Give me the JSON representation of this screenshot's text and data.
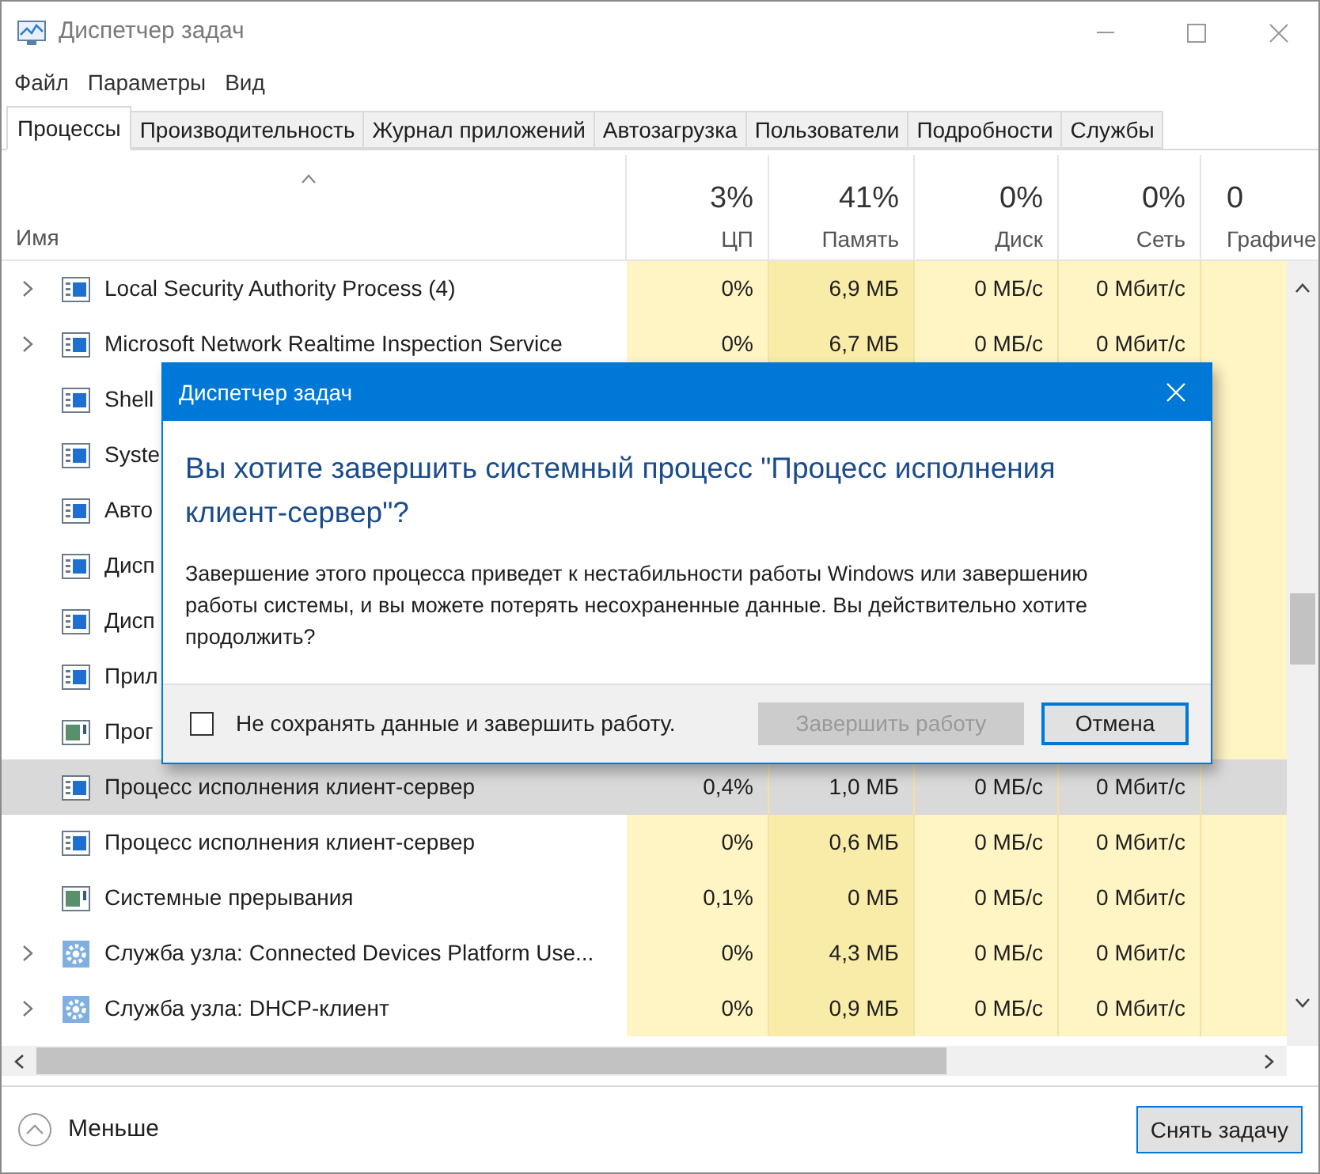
{
  "window": {
    "title": "Диспетчер задач"
  },
  "menu": [
    "Файл",
    "Параметры",
    "Вид"
  ],
  "tabs": [
    {
      "label": "Процессы",
      "selected": true
    },
    {
      "label": "Производительность",
      "selected": false
    },
    {
      "label": "Журнал приложений",
      "selected": false
    },
    {
      "label": "Автозагрузка",
      "selected": false
    },
    {
      "label": "Пользователи",
      "selected": false
    },
    {
      "label": "Подробности",
      "selected": false
    },
    {
      "label": "Службы",
      "selected": false
    }
  ],
  "table": {
    "columns": [
      {
        "label": "Имя"
      },
      {
        "total": "3%",
        "label": "ЦП"
      },
      {
        "total": "41%",
        "label": "Память"
      },
      {
        "total": "0%",
        "label": "Диск"
      },
      {
        "total": "0%",
        "label": "Сеть"
      },
      {
        "total": "0",
        "label": "Графиче"
      }
    ],
    "rows": [
      {
        "name": "Local Security Authority Process (4)",
        "kind": "app",
        "expandable": true,
        "selected": false,
        "values": [
          "0%",
          "6,9 МБ",
          "0 МБ/с",
          "0 Мбит/с"
        ]
      },
      {
        "name": "Microsoft Network Realtime Inspection Service",
        "kind": "app",
        "expandable": true,
        "selected": false,
        "values": [
          "0%",
          "6,7 МБ",
          "0 МБ/с",
          "0 Мбит/с"
        ]
      },
      {
        "name": "Shell",
        "kind": "app",
        "expandable": false,
        "selected": false
      },
      {
        "name": "Syste",
        "kind": "app",
        "expandable": false,
        "selected": false
      },
      {
        "name": "Авто",
        "kind": "app",
        "expandable": false,
        "selected": false
      },
      {
        "name": "Дисп",
        "kind": "app",
        "expandable": false,
        "selected": false
      },
      {
        "name": "Дисп",
        "kind": "app",
        "expandable": false,
        "selected": false
      },
      {
        "name": "Прил",
        "kind": "app",
        "expandable": false,
        "selected": false
      },
      {
        "name": "Прог",
        "kind": "system",
        "expandable": false,
        "selected": false
      },
      {
        "name": "Процесс исполнения клиент-сервер",
        "kind": "app",
        "expandable": false,
        "selected": true,
        "values": [
          "0,4%",
          "1,0 МБ",
          "0 МБ/с",
          "0 Мбит/с"
        ]
      },
      {
        "name": "Процесс исполнения клиент-сервер",
        "kind": "app",
        "expandable": false,
        "selected": false,
        "values": [
          "0%",
          "0,6 МБ",
          "0 МБ/с",
          "0 Мбит/с"
        ]
      },
      {
        "name": "Системные прерывания",
        "kind": "system",
        "expandable": false,
        "selected": false,
        "values": [
          "0,1%",
          "0 МБ",
          "0 МБ/с",
          "0 Мбит/с"
        ]
      },
      {
        "name": "Служба узла: Connected Devices Platform Use...",
        "kind": "service",
        "expandable": true,
        "selected": false,
        "values": [
          "0%",
          "4,3 МБ",
          "0 МБ/с",
          "0 Мбит/с"
        ]
      },
      {
        "name": "Служба узла: DHCP-клиент",
        "kind": "service",
        "expandable": true,
        "selected": false,
        "values": [
          "0%",
          "0,9 МБ",
          "0 МБ/с",
          "0 Мбит/с"
        ]
      }
    ]
  },
  "footer": {
    "less": "Меньше",
    "end_task": "Снять задачу"
  },
  "dialog": {
    "title": "Диспетчер задач",
    "heading": "Вы хотите завершить системный процесс \"Процесс исполнения клиент-сервер\"?",
    "message": "Завершение этого процесса приведет к нестабильности работы Windows или завершению работы системы, и вы можете потерять несохраненные данные. Вы действительно хотите продолжить?",
    "checkbox": {
      "label": "Не сохранять данные и завершить работу.",
      "checked": false
    },
    "buttons": [
      {
        "label": "Завершить работу",
        "disabled": true,
        "default": false
      },
      {
        "label": "Отмена",
        "disabled": false,
        "default": true
      }
    ]
  }
}
